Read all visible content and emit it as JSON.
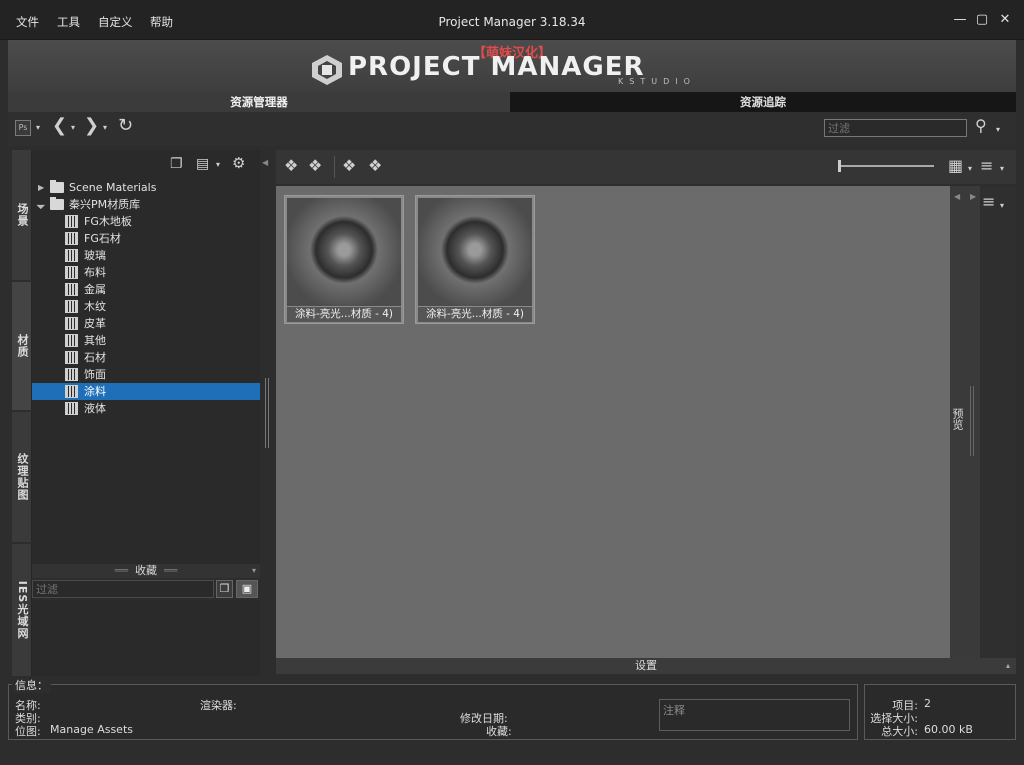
{
  "window": {
    "title": "Project Manager 3.18.34",
    "menu": [
      "文件",
      "工具",
      "自定义",
      "帮助"
    ]
  },
  "banner": {
    "localization_tag": "【萌妹汉化】",
    "product_name": "PROJECT MANAGER",
    "vendor": "KSTUDIO"
  },
  "main_tabs": [
    {
      "label": "资源管理器",
      "active": true
    },
    {
      "label": "资源追踪",
      "active": false
    }
  ],
  "toolbar": {
    "app_badge": "Ps",
    "filter_placeholder": "过滤"
  },
  "side_tabs": [
    {
      "label": "场景",
      "active": false
    },
    {
      "label": "材质",
      "active": true
    },
    {
      "label": "纹理贴图",
      "active": false
    },
    {
      "label": "IES光域网",
      "active": false
    }
  ],
  "tree": {
    "roots": [
      {
        "label": "Scene Materials",
        "expanded": false
      },
      {
        "label": "秦兴PM材质库",
        "expanded": true
      }
    ],
    "children": [
      {
        "label": "FG木地板"
      },
      {
        "label": "FG石材"
      },
      {
        "label": "玻璃"
      },
      {
        "label": "布料"
      },
      {
        "label": "金属"
      },
      {
        "label": "木纹"
      },
      {
        "label": "皮革"
      },
      {
        "label": "其他"
      },
      {
        "label": "石材"
      },
      {
        "label": "饰面"
      },
      {
        "label": "涂料",
        "selected": true
      },
      {
        "label": "液体"
      }
    ]
  },
  "favorites": {
    "title": "收藏",
    "filter_placeholder": "过滤"
  },
  "content": {
    "items": [
      {
        "caption": "涂料-亮光...材质 - 4)"
      },
      {
        "caption": "涂料-亮光...材质 - 4)"
      }
    ],
    "right_tab": "预览",
    "settings_label": "设置"
  },
  "info": {
    "legend": "信息：",
    "name_label": "名称:",
    "category_label": "类别:",
    "location_label": "位图:",
    "location_value": "Manage Assets",
    "renderer_label": "渲染器:",
    "modified_label": "修改日期:",
    "favorite_label": "收藏:",
    "note_placeholder": "注释"
  },
  "stats": {
    "items_label": "项目:",
    "items_value": "2",
    "selected_label": "选择大小:",
    "selected_value": "",
    "total_label": "总大小:",
    "total_value": "60.00 kB"
  },
  "colors": {
    "selection": "#1e6fb8",
    "banner_tag": "#e04b4b",
    "content_bg": "#6b6b6b"
  }
}
